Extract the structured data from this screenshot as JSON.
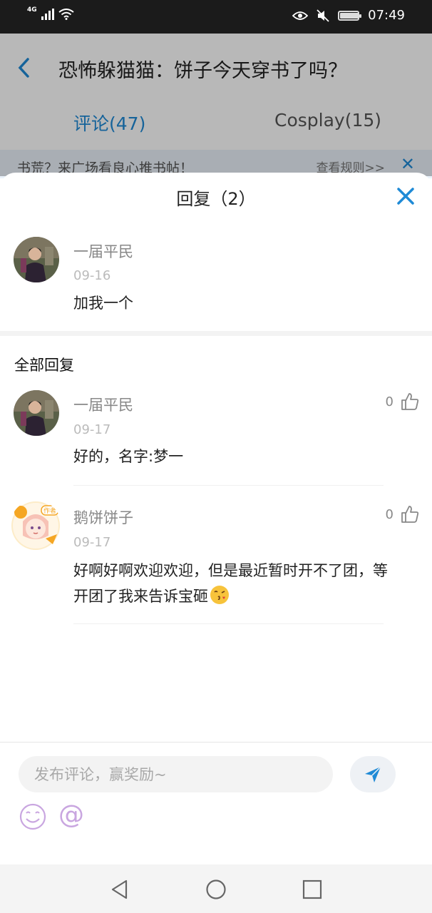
{
  "status_bar": {
    "network": "4G",
    "time": "07:49",
    "battery_level": 0.95
  },
  "background_page": {
    "title": "恐怖躲猫猫：饼子今天穿书了吗？",
    "tabs": [
      {
        "label": "评论(47)",
        "active": true
      },
      {
        "label": "Cosplay(15)",
        "active": false
      }
    ],
    "banner": {
      "text": "书荒？来广场看良心推书帖！",
      "link": "查看规则>>"
    }
  },
  "sheet": {
    "title": "回复（2）",
    "original_comment": {
      "user": "一届平民",
      "date": "09-16",
      "text": "加我一个"
    },
    "section_title": "全部回复",
    "replies": [
      {
        "user": "一届平民",
        "date": "09-17",
        "text": "好的，名字:梦一",
        "likes": "0"
      },
      {
        "user": "鹅饼饼子",
        "date": "09-17",
        "text": "好啊好啊欢迎欢迎，但是最近暂时开不了团，等开团了我来告诉宝砸",
        "likes": "0",
        "avatar_badge": "作者"
      }
    ]
  },
  "input": {
    "placeholder": "发布评论，赢奖励~"
  },
  "colors": {
    "accent": "#1f8ad6",
    "icon_purple": "#c9a6e0"
  }
}
